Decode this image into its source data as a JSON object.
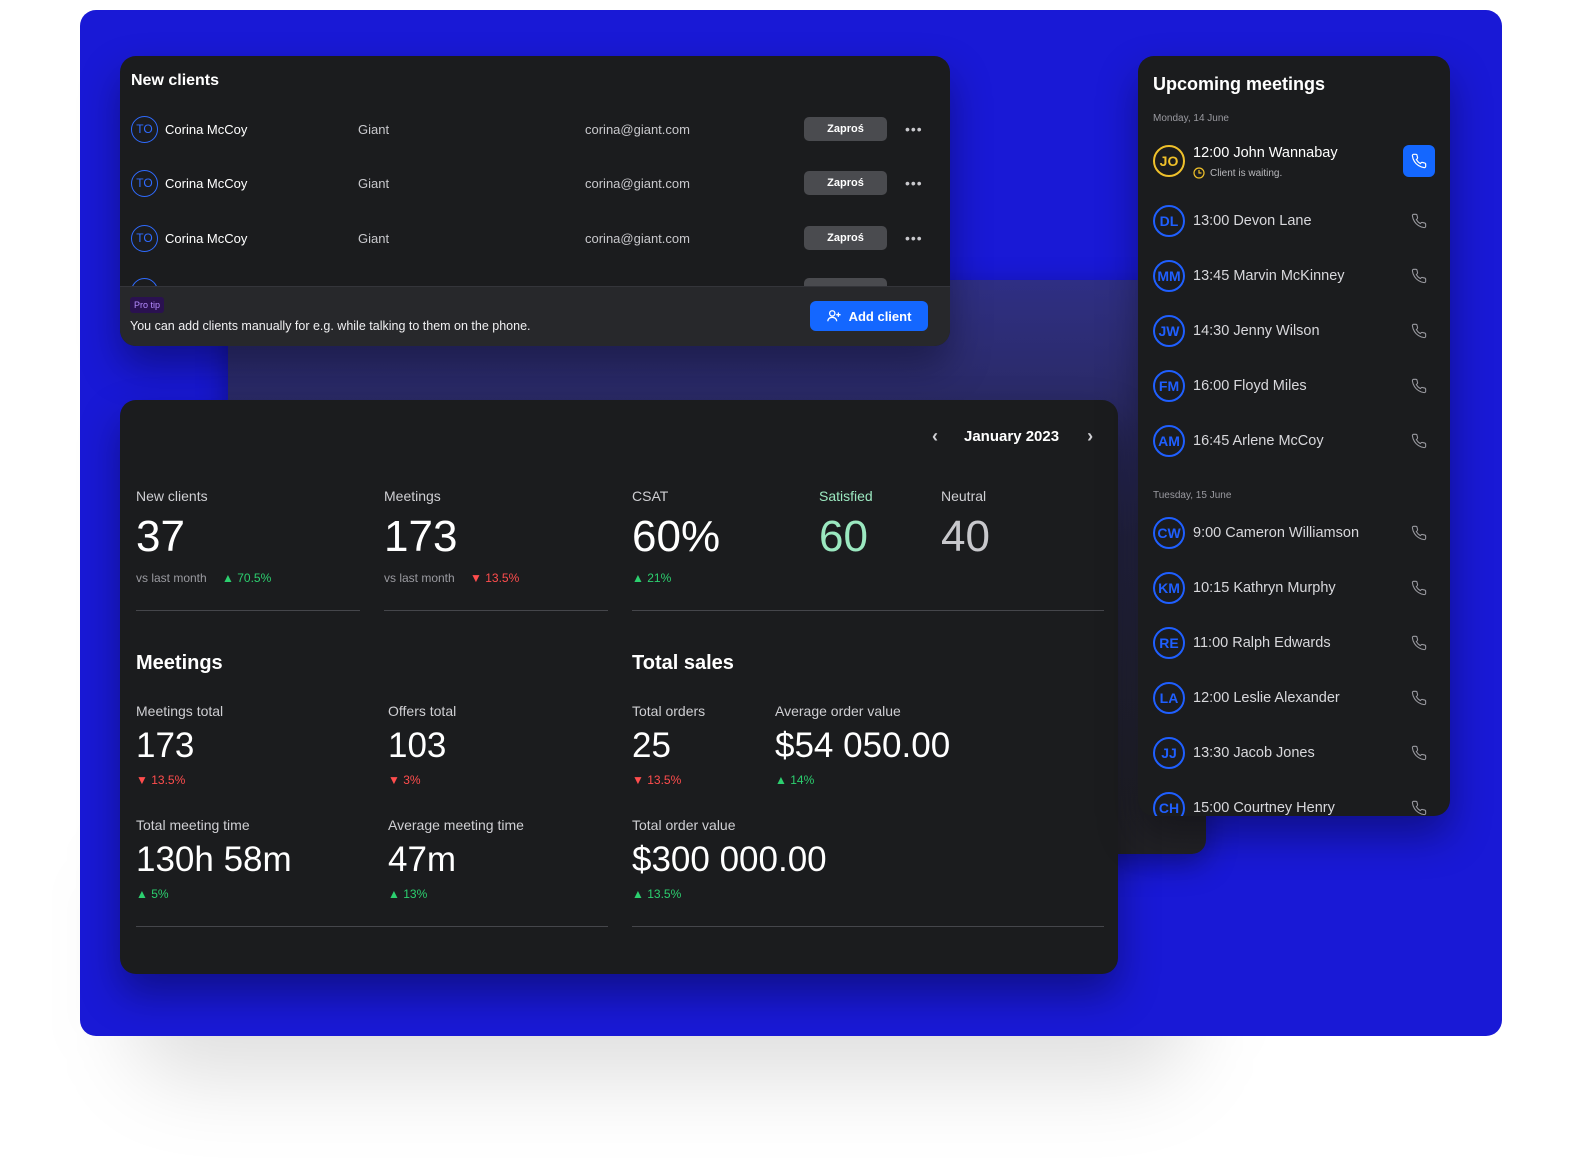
{
  "colors": {
    "background_blue": "#1919d6",
    "card": "#1b1c1e",
    "accent_blue": "#1467ff",
    "positive": "#2ccf6f",
    "negative": "#ff4d4d",
    "satisfied": "#9be8c0",
    "waiting_yellow": "#f0c12a"
  },
  "new_clients": {
    "title": "New clients",
    "rows": [
      {
        "initials": "TO",
        "name": "Corina McCoy",
        "company": "Giant",
        "email": "corina@giant.com",
        "invite_label": "Zaproś",
        "more_icon": "more-horizontal-icon"
      },
      {
        "initials": "TO",
        "name": "Corina McCoy",
        "company": "Giant",
        "email": "corina@giant.com",
        "invite_label": "Zaproś",
        "more_icon": "more-horizontal-icon"
      },
      {
        "initials": "TO",
        "name": "Corina McCoy",
        "company": "Giant",
        "email": "corina@giant.com",
        "invite_label": "Zaproś",
        "more_icon": "more-horizontal-icon"
      }
    ],
    "pro_tip_badge": "Pro tip",
    "pro_tip_text": "You can add clients manually for e.g. while talking to them on the phone.",
    "add_client_label": "Add client"
  },
  "stats": {
    "month": "January 2023",
    "new_clients": {
      "label": "New clients",
      "value": "37",
      "sub": "vs last month",
      "delta": "70.5%",
      "trend": "up"
    },
    "meetings": {
      "label": "Meetings",
      "value": "173",
      "sub": "vs last month",
      "delta": "13.5%",
      "trend": "down"
    },
    "csat": {
      "label": "CSAT",
      "value": "60%",
      "delta": "21%",
      "trend": "up"
    },
    "satisfied": {
      "label": "Satisfied",
      "value": "60"
    },
    "neutral": {
      "label": "Neutral",
      "value": "40"
    },
    "meetings_section": {
      "title": "Meetings",
      "meetings_total": {
        "label": "Meetings total",
        "value": "173",
        "delta": "13.5%",
        "trend": "down"
      },
      "offers_total": {
        "label": "Offers total",
        "value": "103",
        "delta": "3%",
        "trend": "down"
      },
      "total_meeting_time": {
        "label": "Total meeting time",
        "value": "130h 58m",
        "delta": "5%",
        "trend": "up"
      },
      "average_meeting_time": {
        "label": "Average meeting time",
        "value": "47m",
        "delta": "13%",
        "trend": "up"
      }
    },
    "sales_section": {
      "title": "Total sales",
      "total_orders": {
        "label": "Total orders",
        "value": "25",
        "delta": "13.5%",
        "trend": "down"
      },
      "average_order_value": {
        "label": "Average order value",
        "value": "$54 050.00",
        "delta": "14%",
        "trend": "up"
      },
      "total_order_value": {
        "label": "Total order value",
        "value": "$300 000.00",
        "delta": "13.5%",
        "trend": "up"
      }
    }
  },
  "upcoming_meetings": {
    "title": "Upcoming meetings",
    "days": [
      {
        "date": "Monday, 14 June",
        "meetings": [
          {
            "initials": "JO",
            "text": "12:00 John Wannabay",
            "status": "Client is waiting.",
            "active": true
          },
          {
            "initials": "DL",
            "text": "13:00 Devon Lane"
          },
          {
            "initials": "MM",
            "text": "13:45 Marvin McKinney"
          },
          {
            "initials": "JW",
            "text": "14:30 Jenny Wilson"
          },
          {
            "initials": "FM",
            "text": "16:00 Floyd Miles"
          },
          {
            "initials": "AM",
            "text": "16:45 Arlene McCoy"
          }
        ]
      },
      {
        "date": "Tuesday, 15 June",
        "meetings": [
          {
            "initials": "CW",
            "text": "9:00 Cameron Williamson"
          },
          {
            "initials": "KM",
            "text": "10:15 Kathryn Murphy"
          },
          {
            "initials": "RE",
            "text": "11:00 Ralph Edwards"
          },
          {
            "initials": "LA",
            "text": "12:00 Leslie Alexander"
          },
          {
            "initials": "JJ",
            "text": "13:30 Jacob Jones"
          },
          {
            "initials": "CH",
            "text": "15:00 Courtney Henry"
          }
        ]
      }
    ]
  }
}
